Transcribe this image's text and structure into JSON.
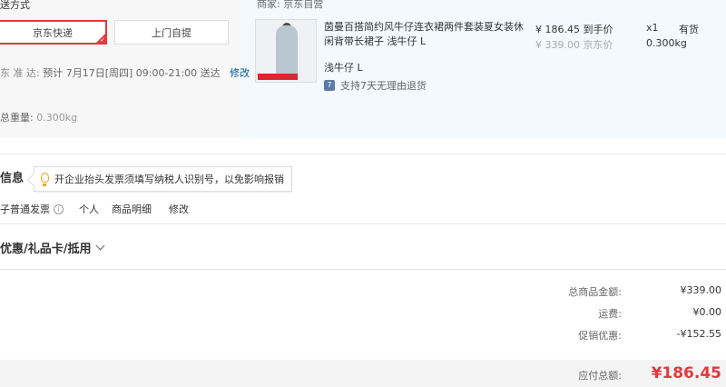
{
  "shipping": {
    "title": "送方式",
    "options": [
      "京东快递",
      "上门自提"
    ],
    "delivery_label": "东 准 达:",
    "delivery_text": "预计 7月17日[周四] 09:00-21:00 送达",
    "edit_label": "修改",
    "weight_label": "总重量:",
    "weight_value": "0.300kg"
  },
  "order": {
    "seller": "商家:  京东自营",
    "product_name": "茵曼百搭简约风牛仔连衣裙两件套装夏女装休闲背带长裙子 浅牛仔 L",
    "spec": "浅牛仔 L",
    "return_policy": "支持7天无理由退货",
    "return_icon": "7",
    "price": "¥ 186.45  到手价",
    "original_price": "¥ 339.00  京东价",
    "quantity": "x1",
    "stock": "有货",
    "weight": "0.300kg"
  },
  "invoice": {
    "title": "信息",
    "tip": "开企业抬头发票须填写纳税人识别号，以免影响报销",
    "type": "子普通发票",
    "info_icon": "i",
    "holder": "个人",
    "content": "商品明细",
    "edit_label": "修改"
  },
  "coupons": {
    "title": "优惠/礼品卡/抵用"
  },
  "summary": {
    "rows": [
      {
        "label": "总商品金额:",
        "value": "¥339.00"
      },
      {
        "label": "运费:",
        "value": "¥0.00"
      },
      {
        "label": "促销优惠:",
        "value": "-¥152.55"
      }
    ],
    "total_label": "应付总额:",
    "total_value": "¥186.45"
  },
  "colors": {
    "accent": "#e4393c",
    "link": "#005aa0",
    "product_bg": "#f3f9fd"
  }
}
